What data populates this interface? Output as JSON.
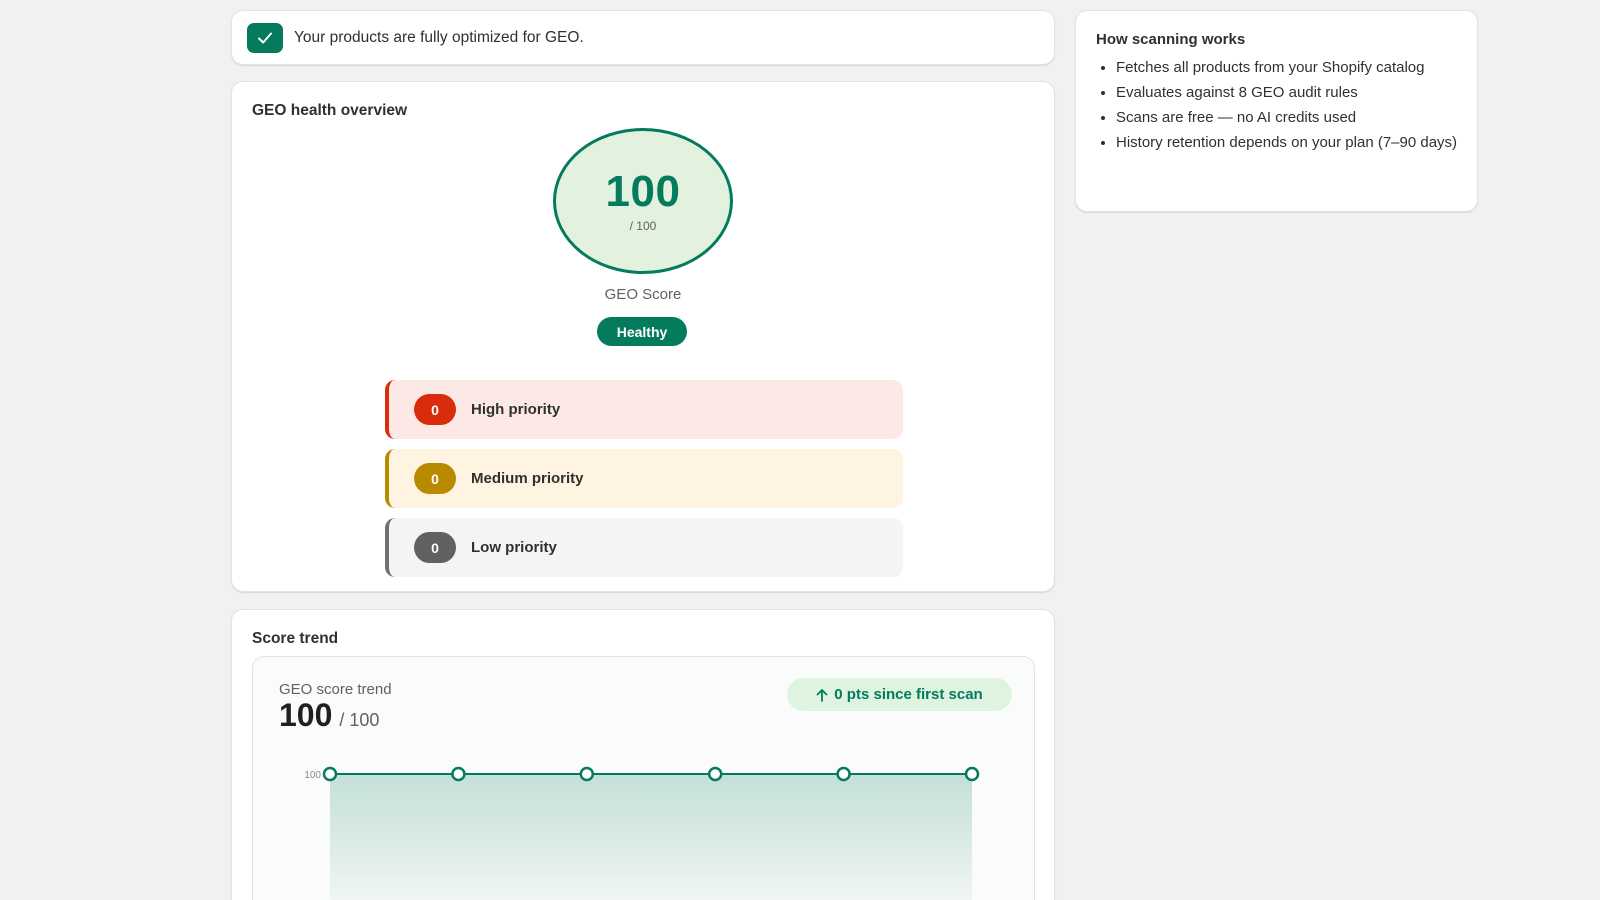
{
  "banner": {
    "text": "Your products are fully optimized for GEO.",
    "icon": "checkmark-icon"
  },
  "overview": {
    "title": "GEO health overview",
    "score": "100",
    "score_max": "/ 100",
    "score_label": "GEO Score",
    "status": "Healthy",
    "priorities": [
      {
        "count": "0",
        "label": "High priority",
        "color": "#d82c0d"
      },
      {
        "count": "0",
        "label": "Medium priority",
        "color": "#b98900"
      },
      {
        "count": "0",
        "label": "Low priority",
        "color": "#616161"
      }
    ]
  },
  "trend": {
    "title": "Score trend",
    "label": "GEO score trend",
    "value": "100",
    "value_max": "/ 100",
    "delta": "0 pts since first scan",
    "delta_icon": "arrow-up-icon"
  },
  "howto": {
    "title": "How scanning works",
    "items": [
      "Fetches all products from your Shopify catalog",
      "Evaluates against 8 GEO audit rules",
      "Scans are free — no AI credits used",
      "History retention depends on your plan (7–90 days)"
    ]
  },
  "colors": {
    "accent": "#047b5d",
    "accent_light": "#e3f1df"
  },
  "chart_data": {
    "type": "line",
    "x": [
      1,
      2,
      3,
      4,
      5,
      6
    ],
    "series": [
      {
        "values": [
          100,
          100,
          100,
          100,
          100,
          100
        ]
      }
    ],
    "ytick_labels": [
      "100"
    ]
  }
}
